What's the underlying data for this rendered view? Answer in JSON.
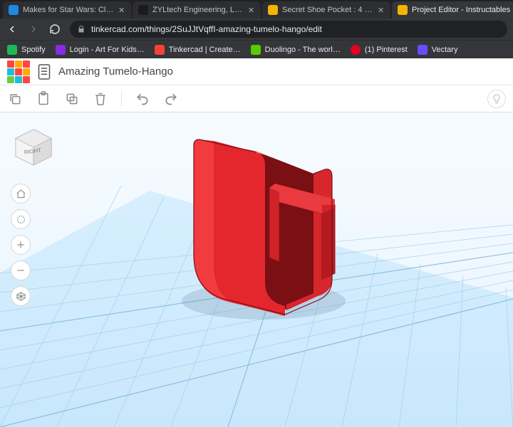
{
  "browser": {
    "tabs": [
      {
        "title": "Makes for Star Wars: Clone Ai…",
        "fav": "#1e88e5"
      },
      {
        "title": "ZYLtech Engineering, LLC - Sho…",
        "fav": "#1b1b1b"
      },
      {
        "title": "Secret Shoe Pocket : 4 Steps - I…",
        "fav": "#f5b400"
      },
      {
        "title": "Project Editor - Instructables",
        "fav": "#f5b400"
      }
    ],
    "active_tab_index": 3,
    "url": "tinkercad.com/things/2SuJJtVqffI-amazing-tumelo-hango/edit",
    "bookmarks": [
      {
        "label": "Spotify",
        "fav": "#1db954"
      },
      {
        "label": "Login - Art For Kids…",
        "fav": "#8a2be2"
      },
      {
        "label": "Tinkercad | Create…",
        "fav": "#f44336"
      },
      {
        "label": "Duolingo - The worl…",
        "fav": "#58cc02"
      },
      {
        "label": "(1) Pinterest",
        "fav": "#e60023"
      },
      {
        "label": "Vectary",
        "fav": "#6a4cff"
      }
    ]
  },
  "tinkercad": {
    "project_title": "Amazing Tumelo-Hango",
    "view_cube_face": "RIGHT",
    "model_color": "#d4232a"
  }
}
